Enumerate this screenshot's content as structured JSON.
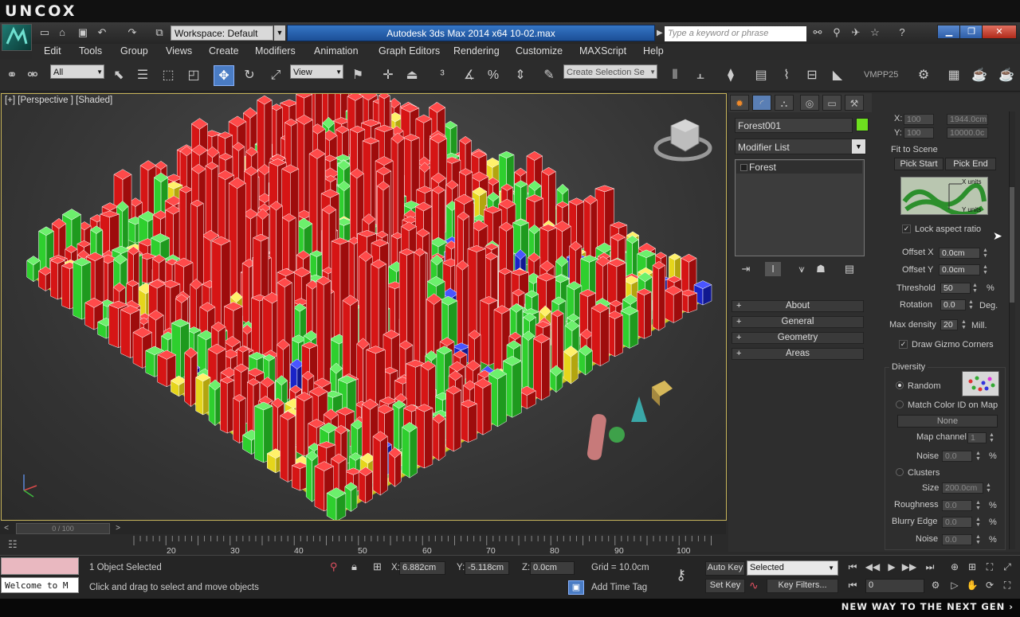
{
  "brand": "UNCOX",
  "window": {
    "workspace": "Workspace: Default",
    "title": "Autodesk 3ds Max  2014 x64      10-02.max",
    "search_placeholder": "Type a keyword or phrase"
  },
  "menu": [
    "Edit",
    "Tools",
    "Group",
    "Views",
    "Create",
    "Modifiers",
    "Animation",
    "Graph Editors",
    "Rendering",
    "Customize",
    "MAXScript",
    "Help"
  ],
  "toolbar": {
    "selection_filter": "All",
    "ref_coord": "View",
    "named_selection_placeholder": "Create Selection Se",
    "vmpp": "VMPP25"
  },
  "viewport": {
    "label": "[+] [Perspective ] [Shaded]",
    "slider": "0 / 100",
    "ruler": [
      "20",
      "30",
      "40",
      "50",
      "60",
      "70",
      "80",
      "90",
      "100"
    ]
  },
  "panel": {
    "object_name": "Forest001",
    "object_color": "#6ee01f",
    "modifier_list": "Modifier List",
    "stack": [
      "Forest"
    ],
    "rollouts": [
      "About",
      "General",
      "Geometry",
      "Areas"
    ],
    "x_label": "X:",
    "x_val": "100",
    "x_size": "1944.0cm",
    "y_label": "Y:",
    "y_val": "100",
    "y_size": "10000.0c",
    "fit_to_scene": "Fit to Scene",
    "pick_start": "Pick Start",
    "pick_end": "Pick End",
    "x_units": "X units",
    "y_units": "Y units",
    "lock_aspect": "Lock aspect ratio",
    "offset_x_label": "Offset X",
    "offset_x": "0.0cm",
    "offset_y_label": "Offset Y",
    "offset_y": "0.0cm",
    "threshold_label": "Threshold",
    "threshold": "50",
    "threshold_unit": "%",
    "rotation_label": "Rotation",
    "rotation": "0.0",
    "rotation_unit": "Deg.",
    "max_density_label": "Max density",
    "max_density": "20",
    "max_density_unit": "Mill.",
    "draw_gizmo": "Draw Gizmo Corners",
    "diversity": "Diversity",
    "random": "Random",
    "match_color": "Match Color ID on Map",
    "none_btn": "None",
    "map_channel_label": "Map channel",
    "map_channel": "1",
    "noise_label": "Noise",
    "noise": "0.0",
    "clusters": "Clusters",
    "size_label": "Size",
    "size": "200.0cm",
    "roughness_label": "Roughness",
    "roughness": "0.0",
    "blurry_label": "Blurry Edge",
    "blurry": "0.0",
    "noise2_label": "Noise",
    "noise2": "0.0",
    "pct": "%"
  },
  "status": {
    "selection": "1 Object Selected",
    "prompt": "Click and drag to select and move objects",
    "listener": "Welcome to M",
    "x": "6.882cm",
    "y": "-5.118cm",
    "z": "0.0cm",
    "grid": "Grid = 10.0cm",
    "add_time_tag": "Add Time Tag",
    "auto_key": "Auto Key",
    "set_key": "Set Key",
    "key_filter": "Selected",
    "key_filters": "Key Filters...",
    "frame": "0"
  },
  "footer": "NEW WAY TO THE NEXT GEN ›"
}
